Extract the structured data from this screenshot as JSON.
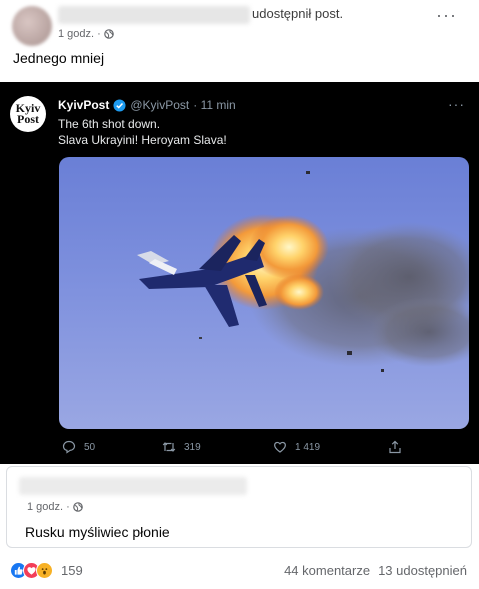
{
  "post": {
    "shared_text": "udostępnił post.",
    "time": "1 godz. ·",
    "caption": "Jednego mniej",
    "more": "···"
  },
  "tweet": {
    "logo_line1": "Kyiv",
    "logo_line2": "Post",
    "name": "KyivPost",
    "handle": "@KyivPost",
    "time": "· 11 min",
    "line1": "The 6th shot down.",
    "line2": "Slava Ukrayini! Heroyam Slava!",
    "more": "···",
    "replies": "50",
    "retweets": "319",
    "likes": "1 419"
  },
  "comment": {
    "time": "1 godz. ·",
    "text": "Rusku myśliwiec płonie"
  },
  "footer": {
    "reaction_count": "159",
    "comments": "44 komentarze",
    "shares": "13 udostępnień"
  },
  "colors": {
    "facebook_blue": "#1877f2",
    "love_red": "#f33e58",
    "wow_yellow": "#f7b125",
    "twitter_verified": "#1d9bf0"
  }
}
